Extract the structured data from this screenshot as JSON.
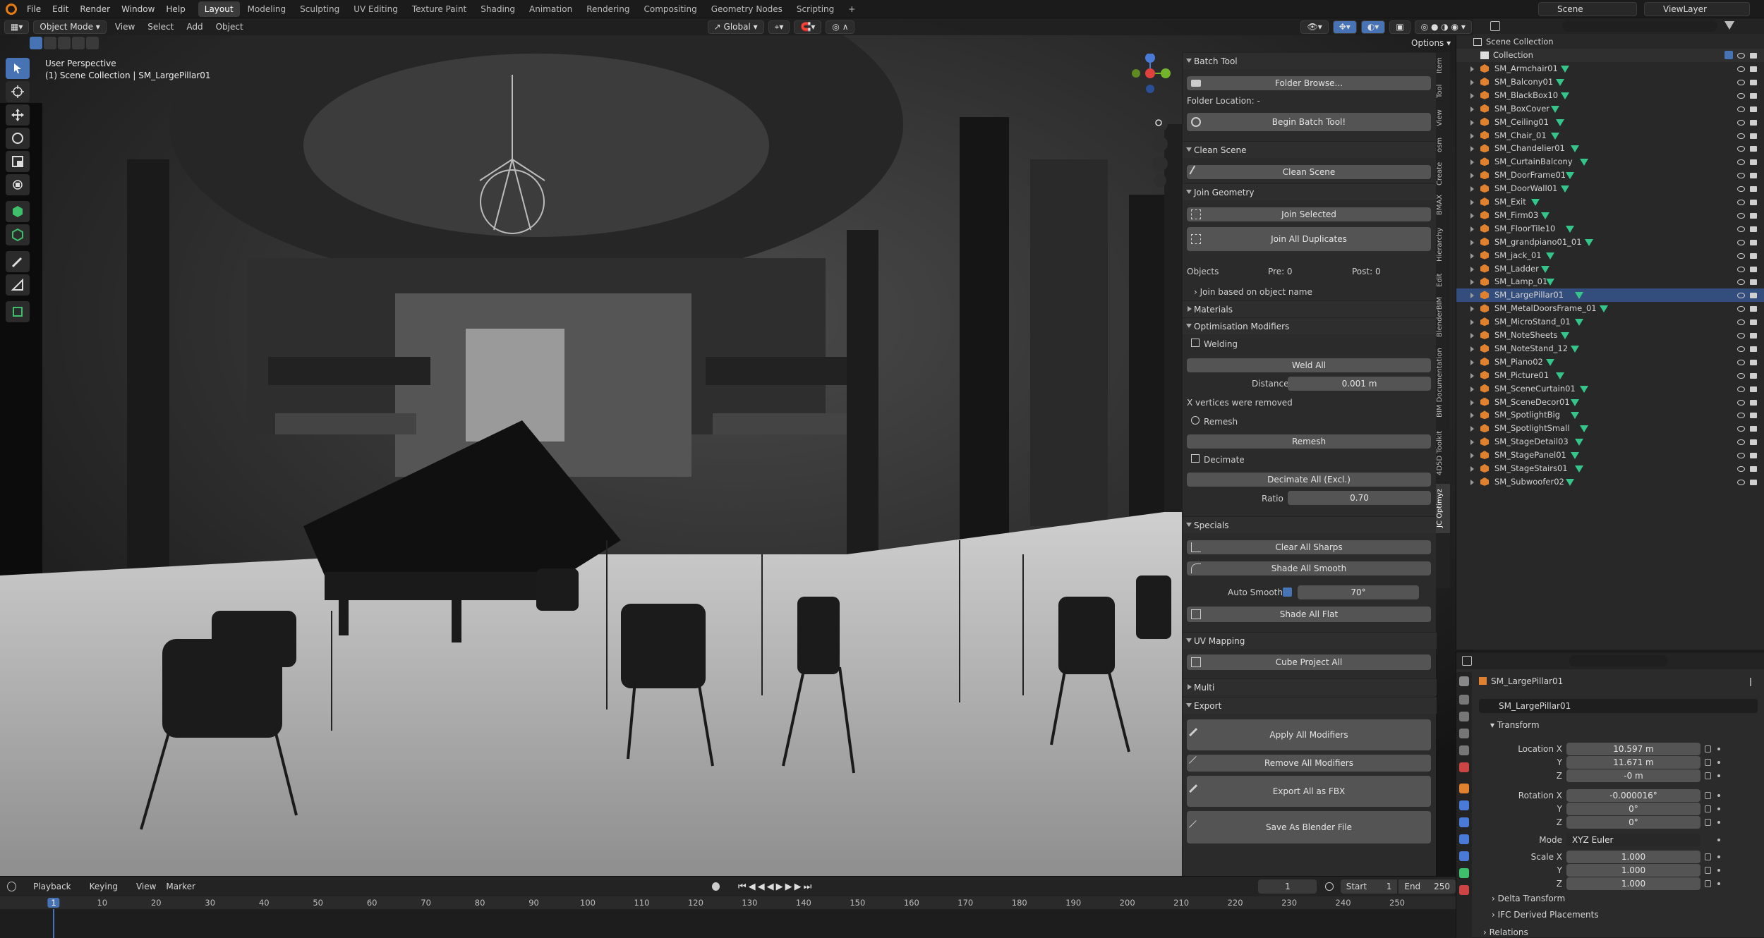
{
  "topbar": {
    "menus": [
      "File",
      "Edit",
      "Render",
      "Window",
      "Help"
    ],
    "workspaces": [
      "Layout",
      "Modeling",
      "Sculpting",
      "UV Editing",
      "Texture Paint",
      "Shading",
      "Animation",
      "Rendering",
      "Compositing",
      "Geometry Nodes",
      "Scripting",
      "+"
    ],
    "active_workspace": "Layout",
    "scene": "Scene",
    "view_layer": "ViewLayer"
  },
  "viewport": {
    "mode": "Object Mode",
    "menus": [
      "View",
      "Select",
      "Add",
      "Object"
    ],
    "orientation": "Global",
    "options_label": "Options",
    "perspective": "User Perspective",
    "collection_info": "(1) Scene Collection | SM_LargePillar01"
  },
  "npanel": {
    "batch_tool": {
      "title": "Batch Tool",
      "folder_browse": "Folder Browse...",
      "folder_location": "Folder Location: -",
      "begin": "Begin Batch Tool!"
    },
    "clean_scene": {
      "title": "Clean Scene",
      "button": "Clean Scene"
    },
    "join_geometry": {
      "title": "Join Geometry",
      "join_selected": "Join Selected",
      "join_all": "Join All Duplicates",
      "objects_label": "Objects",
      "pre": "Pre: 0",
      "post": "Post: 0",
      "join_by_name": "Join based on object name"
    },
    "materials": {
      "title": "Materials"
    },
    "optimisation": {
      "title": "Optimisation Modifiers",
      "welding": "Welding",
      "weld_all": "Weld All",
      "distance_label": "Distance",
      "distance_value": "0.001 m",
      "vertices_removed": "X vertices were removed",
      "remesh_label": "Remesh",
      "remesh_button": "Remesh",
      "decimate_label": "Decimate",
      "decimate_all": "Decimate All (Excl.)",
      "ratio_label": "Ratio",
      "ratio_value": "0.70"
    },
    "specials": {
      "title": "Specials",
      "clear_sharps": "Clear All Sharps",
      "shade_smooth": "Shade All Smooth",
      "auto_smooth_label": "Auto Smooth",
      "auto_smooth_value": "70°",
      "shade_flat": "Shade All Flat"
    },
    "uv_mapping": {
      "title": "UV Mapping",
      "cube_project": "Cube Project All"
    },
    "multi": {
      "title": "Multi"
    },
    "export": {
      "title": "Export",
      "apply_mods": "Apply All Modifiers",
      "remove_mods": "Remove All Modifiers",
      "export_fbx": "Export All as FBX",
      "save_blend": "Save As Blender File"
    }
  },
  "vertical_tabs": [
    "Item",
    "Tool",
    "View",
    "osm",
    "Create",
    "BMAX",
    "Hierarchy",
    "Edit",
    "BlenderBIM",
    "BIM Documentation",
    "4D5D Toolkit",
    "JC Optimyz"
  ],
  "outliner": {
    "root": "Scene Collection",
    "collection": "Collection",
    "items": [
      "SM_Armchair01",
      "SM_Balcony01",
      "SM_BlackBox10",
      "SM_BoxCover",
      "SM_Ceiling01",
      "SM_Chair_01",
      "SM_Chandelier01",
      "SM_CurtainBalcony",
      "SM_DoorFrame01",
      "SM_DoorWall01",
      "SM_Exit",
      "SM_Firm03",
      "SM_FloorTile10",
      "SM_grandpiano01_01",
      "SM_jack_01",
      "SM_Ladder",
      "SM_Lamp_01",
      "SM_LargePillar01",
      "SM_MetalDoorsFrame_01",
      "SM_MicroStand_01",
      "SM_NoteSheets",
      "SM_NoteStand_12",
      "SM_Piano02",
      "SM_Picture01",
      "SM_SceneCurtain01",
      "SM_SceneDecor01",
      "SM_SpotlightBig",
      "SM_SpotlightSmall",
      "SM_StageDetail03",
      "SM_StagePanel01",
      "SM_StageStairs01",
      "SM_Subwoofer02"
    ],
    "selected": "SM_LargePillar01"
  },
  "properties": {
    "object_name": "SM_LargePillar01",
    "object_field": "SM_LargePillar01",
    "transform_title": "Transform",
    "location_label": "Location X",
    "loc": [
      "10.597 m",
      "11.671 m",
      "-0 m"
    ],
    "rotation_label": "Rotation X",
    "rot": [
      "-0.000016°",
      "0°",
      "0°"
    ],
    "mode_label": "Mode",
    "mode_value": "XYZ Euler",
    "scale_label": "Scale X",
    "scale": [
      "1.000",
      "1.000",
      "1.000"
    ],
    "axis_y": "Y",
    "axis_z": "Z",
    "delta": "Delta Transform",
    "ifc": "IFC Derived Placements",
    "relations": "Relations"
  },
  "timeline": {
    "menus": [
      "Playback",
      "Keying",
      "View",
      "Marker"
    ],
    "current_frame": "1",
    "start_label": "Start",
    "start": "1",
    "end_label": "End",
    "end": "250",
    "ticks": [
      "1",
      "10",
      "20",
      "30",
      "40",
      "50",
      "60",
      "70",
      "80",
      "90",
      "100",
      "110",
      "120",
      "130",
      "140",
      "150",
      "160",
      "170",
      "180",
      "190",
      "200",
      "210",
      "220",
      "230",
      "240",
      "250"
    ]
  }
}
